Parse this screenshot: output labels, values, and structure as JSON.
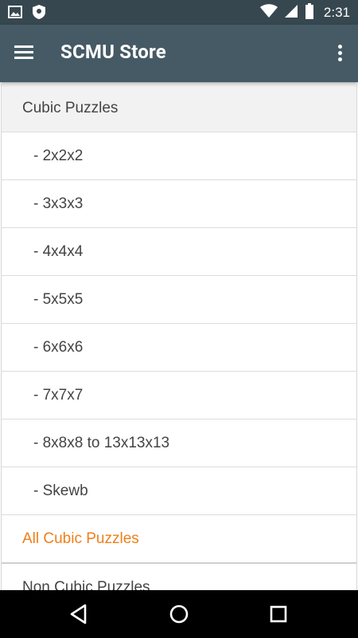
{
  "status_bar": {
    "time": "2:31",
    "icons": [
      "image-icon",
      "shield-icon",
      "wifi-icon",
      "signal-icon",
      "battery-icon"
    ]
  },
  "app_bar": {
    "title": "SCMU Store",
    "menu_icon": "hamburger-menu-icon",
    "overflow_icon": "more-vert-icon"
  },
  "list": {
    "section_header": "Cubic Puzzles",
    "items": [
      "- 2x2x2",
      "- 3x3x3",
      "- 4x4x4",
      "- 5x5x5",
      "- 6x6x6",
      "- 7x7x7",
      "- 8x8x8 to 13x13x13",
      "- Skewb"
    ],
    "all_link": "All Cubic Puzzles",
    "next_section": "Non Cubic Puzzles"
  },
  "colors": {
    "status_bar": "#37474f",
    "app_bar": "#455a64",
    "accent": "#ef7f1a",
    "header_bg": "#f2f2f2"
  },
  "nav_bar": {
    "icons": [
      "back-icon",
      "home-icon",
      "recents-icon"
    ]
  }
}
